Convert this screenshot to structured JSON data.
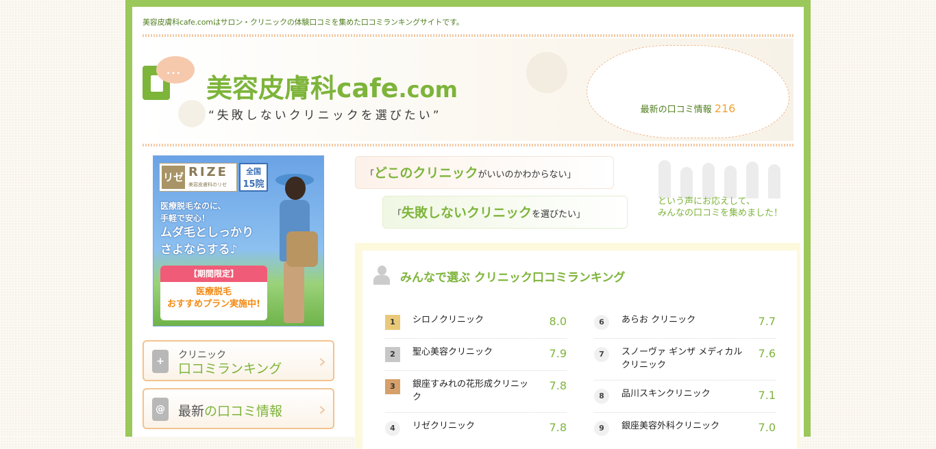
{
  "header": {
    "tagline": "美容皮膚科cafe.comはサロン・クリニックの体験口コミを集めた口コミランキングサイトです。",
    "site_title_main": "美容皮膚科cafe",
    "site_title_domain": ".com",
    "site_subtitle": "“失敗しないクリニックを選びたい”",
    "reviews_label": "最新の口コミ情報",
    "reviews_count": "216"
  },
  "banner": {
    "brand_mark": "リゼ",
    "brand_name": "RIZE",
    "brand_sub": "美容皮膚科のリゼ",
    "clinics_line1": "全国",
    "clinics_line2": "15院",
    "copy_line1": "医療脱毛なのに、",
    "copy_line2": "手軽で安心！",
    "copy_line3": "ムダ毛としっかり",
    "copy_line4": "さよならする♪",
    "offer_head": "【期間限定】",
    "offer_line1": "医療脱毛",
    "offer_line2": "おすすめプラン実施中!"
  },
  "sidebar": {
    "ranking_small": "クリニック",
    "ranking_big": "口コミランキング",
    "latest_prefix": "最新",
    "latest_accent": "の口コミ情報"
  },
  "speech": {
    "s1_open": "「",
    "s1_strong": "どこのクリニック",
    "s1_rest": "がいいのかわからない」",
    "s2_open": "「",
    "s2_strong": "失敗しないクリニック",
    "s2_rest": "を選びたい」",
    "response_line1": "という声にお応えして、",
    "response_line2": "みんなの口コミを集めました！"
  },
  "ranking": {
    "title": "みんなで選ぶ クリニック口コミランキング",
    "left": [
      {
        "rank": "1",
        "name": "シロノクリニック",
        "score": "8.0"
      },
      {
        "rank": "2",
        "name": "聖心美容クリニック",
        "score": "7.9"
      },
      {
        "rank": "3",
        "name": "銀座すみれの花形成クリニック",
        "score": "7.8"
      },
      {
        "rank": "4",
        "name": "リゼクリニック",
        "score": "7.8"
      }
    ],
    "right": [
      {
        "rank": "6",
        "name": "あらお クリニック",
        "score": "7.7"
      },
      {
        "rank": "7",
        "name": "スノーヴァ ギンザ メディカル クリニック",
        "score": "7.6"
      },
      {
        "rank": "8",
        "name": "品川スキンクリニック",
        "score": "7.1"
      },
      {
        "rank": "9",
        "name": "銀座美容外科クリニック",
        "score": "7.0"
      }
    ]
  },
  "colors": {
    "frame": "#9bc85a",
    "accent_green": "#7db43a",
    "accent_orange": "#f1a235"
  }
}
